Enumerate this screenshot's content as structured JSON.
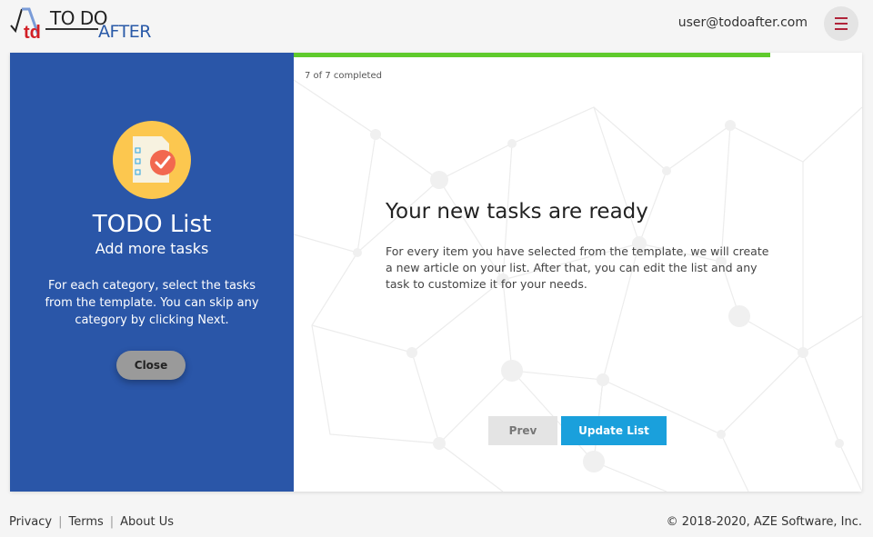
{
  "header": {
    "logo": {
      "mark": "td",
      "line1": "TO DO",
      "line2": "AFTER"
    },
    "user_email": "user@todoafter.com",
    "menu_icon": "hamburger-icon"
  },
  "sidebar": {
    "icon": "checklist-icon",
    "title": "TODO List",
    "subtitle": "Add more tasks",
    "description": "For each category, select the tasks from the template. You can skip any category by clicking Next.",
    "close_label": "Close"
  },
  "wizard": {
    "progress_fraction": 1.0,
    "progress_text": "7 of 7 completed",
    "title": "Your new tasks are ready",
    "description": "For every item you have selected from the template, we will create a new article on your list. After that, you can edit the list and any task to customize it for your needs.",
    "prev_label": "Prev",
    "update_label": "Update List"
  },
  "footer": {
    "links": [
      "Privacy",
      "Terms",
      "About Us"
    ],
    "copyright": "© 2018-2020, AZE Software, Inc."
  },
  "colors": {
    "sidebar_bg": "#2a56a8",
    "progress": "#5fca2c",
    "primary_button": "#1aa0dc",
    "icon_circle": "#fcc74f",
    "menu_accent": "#b0243a"
  }
}
